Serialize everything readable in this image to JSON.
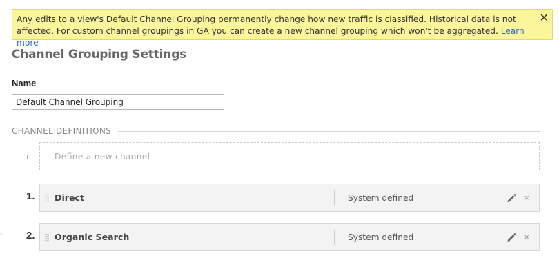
{
  "notice": {
    "message": "Any edits to a view's Default Channel Grouping permanently change how new traffic is classified. Historical data is not affected. For custom channel groupings in GA you can create a new channel grouping which won't be aggregated. ",
    "link_label": "Learn more",
    "close_label": "✕"
  },
  "page": {
    "title": "Channel Grouping Settings"
  },
  "name_field": {
    "label": "Name",
    "value": "Default Channel Grouping"
  },
  "definitions": {
    "header": "CHANNEL DEFINITIONS",
    "add_symbol": "+",
    "add_label": "Define a new channel",
    "channels": [
      {
        "number": "1.",
        "name": "Direct",
        "status": "System defined"
      },
      {
        "number": "2.",
        "name": "Organic Search",
        "status": "System defined"
      }
    ],
    "remove_symbol": "×"
  },
  "colors": {
    "notice_bg": "#fbf59b",
    "link": "#2a6ccb",
    "row_bg": "#f3f3f3"
  },
  "icons": {
    "close": "close-icon",
    "edit": "pencil-icon",
    "remove": "remove-icon",
    "drag": "drag-handle-icon"
  }
}
